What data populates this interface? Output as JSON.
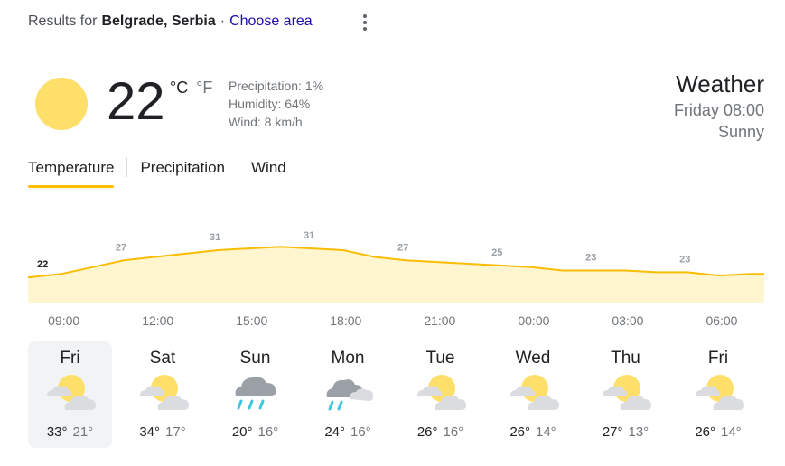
{
  "header": {
    "results_for": "Results for",
    "location": "Belgrade, Serbia",
    "separator": "·",
    "choose_area": "Choose area",
    "more_options_icon": "more-vert-icon"
  },
  "current": {
    "temperature": "22",
    "unit_c": "°C",
    "unit_f": "°F",
    "precipitation": "Precipitation: 1%",
    "humidity": "Humidity: 64%",
    "wind": "Wind: 8 km/h",
    "icon": "sunny-icon",
    "colors": {
      "sun": "#fddf69",
      "accent": "#fbbc04",
      "chart_fill": "#fff6cf"
    }
  },
  "summary": {
    "title": "Weather",
    "time": "Friday 08:00",
    "condition": "Sunny"
  },
  "tabs": [
    {
      "label": "Temperature",
      "active": true
    },
    {
      "label": "Precipitation",
      "active": false
    },
    {
      "label": "Wind",
      "active": false
    }
  ],
  "chart_data": {
    "type": "area",
    "unit": "°C",
    "x": [
      "08:00",
      "09:00",
      "10:00",
      "11:00",
      "12:00",
      "13:00",
      "14:00",
      "15:00",
      "16:00",
      "17:00",
      "18:00",
      "19:00",
      "20:00",
      "21:00",
      "22:00",
      "23:00",
      "00:00",
      "01:00",
      "02:00",
      "03:00",
      "04:00",
      "05:00",
      "06:00",
      "07:00"
    ],
    "values": [
      22,
      23,
      25,
      27,
      28,
      29,
      30,
      30.5,
      31,
      30.5,
      30,
      28,
      27,
      26.5,
      26,
      25.5,
      25,
      24,
      24,
      24,
      23.5,
      23.5,
      22.5,
      23
    ],
    "labels": [
      {
        "x": "08:00",
        "text": "22",
        "current": true
      },
      {
        "x": "11:00",
        "text": "27"
      },
      {
        "x": "14:00",
        "text": "31"
      },
      {
        "x": "17:00",
        "text": "31"
      },
      {
        "x": "20:00",
        "text": "27"
      },
      {
        "x": "23:00",
        "text": "25"
      },
      {
        "x": "02:00",
        "text": "23"
      },
      {
        "x": "05:00",
        "text": "23"
      }
    ],
    "xaxis_ticks": [
      "09:00",
      "12:00",
      "15:00",
      "18:00",
      "21:00",
      "00:00",
      "03:00",
      "06:00"
    ]
  },
  "forecast": [
    {
      "day": "Fri",
      "icon": "partly-cloudy-icon",
      "hi": "33°",
      "lo": "21°",
      "selected": true
    },
    {
      "day": "Sat",
      "icon": "partly-cloudy-icon",
      "hi": "34°",
      "lo": "17°",
      "selected": false
    },
    {
      "day": "Sun",
      "icon": "rain-icon",
      "hi": "20°",
      "lo": "16°",
      "selected": false
    },
    {
      "day": "Mon",
      "icon": "rain-showers-icon",
      "hi": "24°",
      "lo": "16°",
      "selected": false
    },
    {
      "day": "Tue",
      "icon": "partly-cloudy-icon",
      "hi": "26°",
      "lo": "16°",
      "selected": false
    },
    {
      "day": "Wed",
      "icon": "partly-cloudy-icon",
      "hi": "26°",
      "lo": "14°",
      "selected": false
    },
    {
      "day": "Thu",
      "icon": "partly-cloudy-icon",
      "hi": "27°",
      "lo": "13°",
      "selected": false
    },
    {
      "day": "Fri",
      "icon": "partly-cloudy-icon",
      "hi": "26°",
      "lo": "14°",
      "selected": false
    }
  ]
}
